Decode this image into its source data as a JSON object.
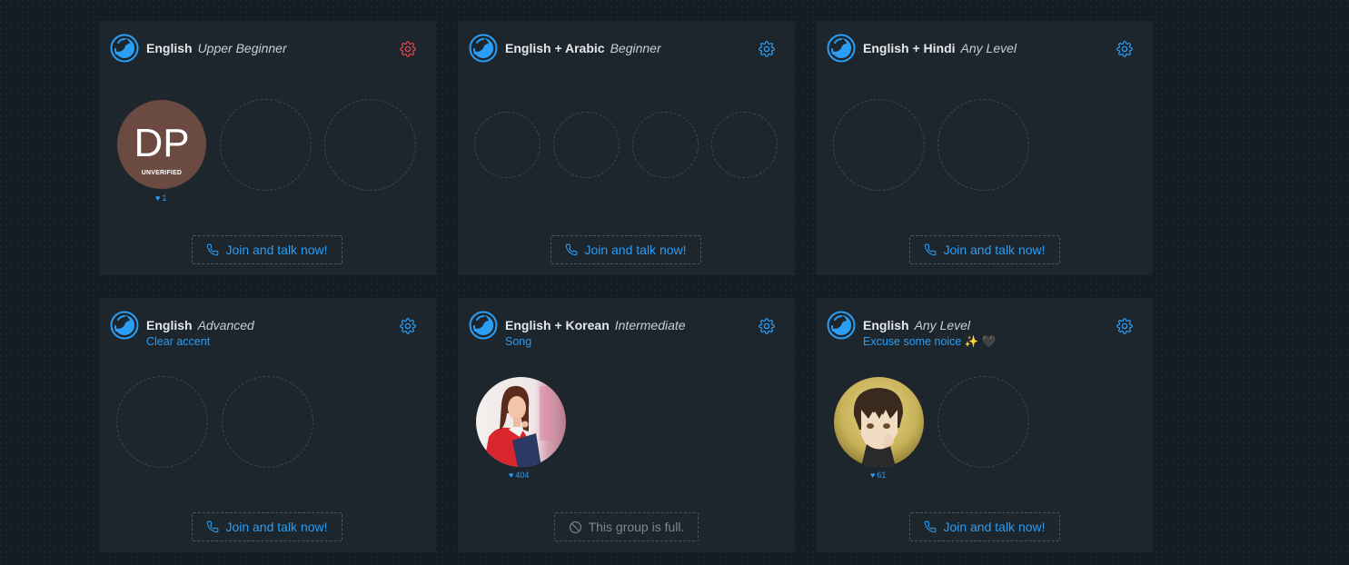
{
  "colors": {
    "page_bg": "#131c24",
    "card_bg": "#1d252d",
    "accent": "#2a9df4",
    "settings_alert": "#e0474c",
    "muted": "#7e878e"
  },
  "groups": [
    {
      "language": "English",
      "level": "Upper Beginner",
      "topic": "",
      "settings_icon": "gear-icon",
      "settings_color": "#e0474c",
      "members": [
        {
          "initials": "DP",
          "badge": "UNVERIFIED",
          "likes": "1"
        }
      ],
      "button_label": "Join and talk now!",
      "button_icon": "phone-icon"
    },
    {
      "language": "English + Arabic",
      "level": "Beginner",
      "topic": "",
      "settings_icon": "gear-icon",
      "settings_color": "#2a9df4",
      "members": [],
      "button_label": "Join and talk now!",
      "button_icon": "phone-icon"
    },
    {
      "language": "English + Hindi",
      "level": "Any Level",
      "topic": "",
      "settings_icon": "gear-icon",
      "settings_color": "#2a9df4",
      "members": [],
      "button_label": "Join and talk now!",
      "button_icon": "phone-icon"
    },
    {
      "language": "English",
      "level": "Advanced",
      "topic": "Clear accent",
      "settings_icon": "gear-icon",
      "settings_color": "#2a9df4",
      "members": [],
      "button_label": "Join and talk now!",
      "button_icon": "phone-icon"
    },
    {
      "language": "English + Korean",
      "level": "Intermediate",
      "topic": "Song",
      "settings_icon": "gear-icon",
      "settings_color": "#2a9df4",
      "members": [
        {
          "photo": "woman-red-jacket-photo",
          "likes": "404"
        }
      ],
      "button_label": "This group is full.",
      "button_icon": "ban-icon"
    },
    {
      "language": "English",
      "level": "Any Level",
      "topic": "Excuse some noice",
      "topic_emoji": "✨ 🖤",
      "settings_icon": "gear-icon",
      "settings_color": "#2a9df4",
      "members": [
        {
          "photo": "anime-boy-photo",
          "likes": "61"
        }
      ],
      "button_label": "Join and talk now!",
      "button_icon": "phone-icon"
    }
  ]
}
